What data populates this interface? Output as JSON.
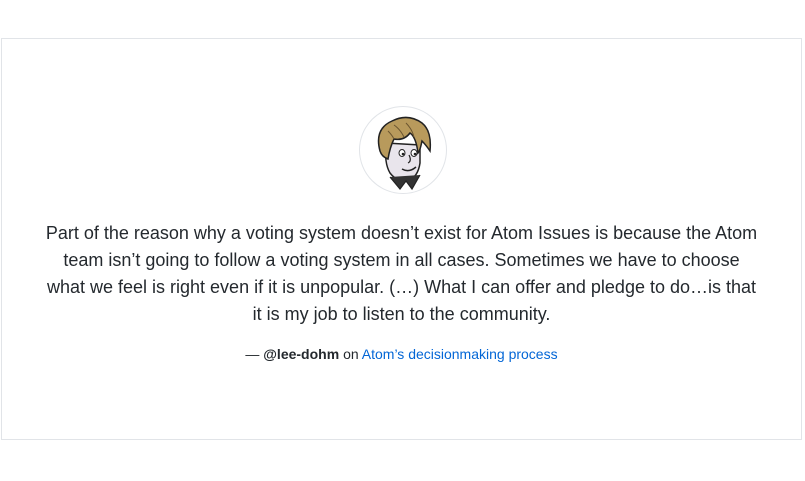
{
  "testimonial": {
    "avatar_icon": "cartoon-avatar-icon",
    "quote": "Part of the reason why a voting system doesn’t exist for Atom Issues is because the Atom team isn’t going to follow a voting system in all cases. Sometimes we have to choose what we feel is right even if it is unpopular. (…) What I can offer and pledge to do…is that it is my job to listen to the community.",
    "dash": "—",
    "author": "@lee-dohm",
    "connector": "on",
    "link_text": "Atom’s decisionmaking process"
  },
  "colors": {
    "text": "#24292e",
    "link": "#0366d6",
    "border": "#e1e4e8"
  }
}
